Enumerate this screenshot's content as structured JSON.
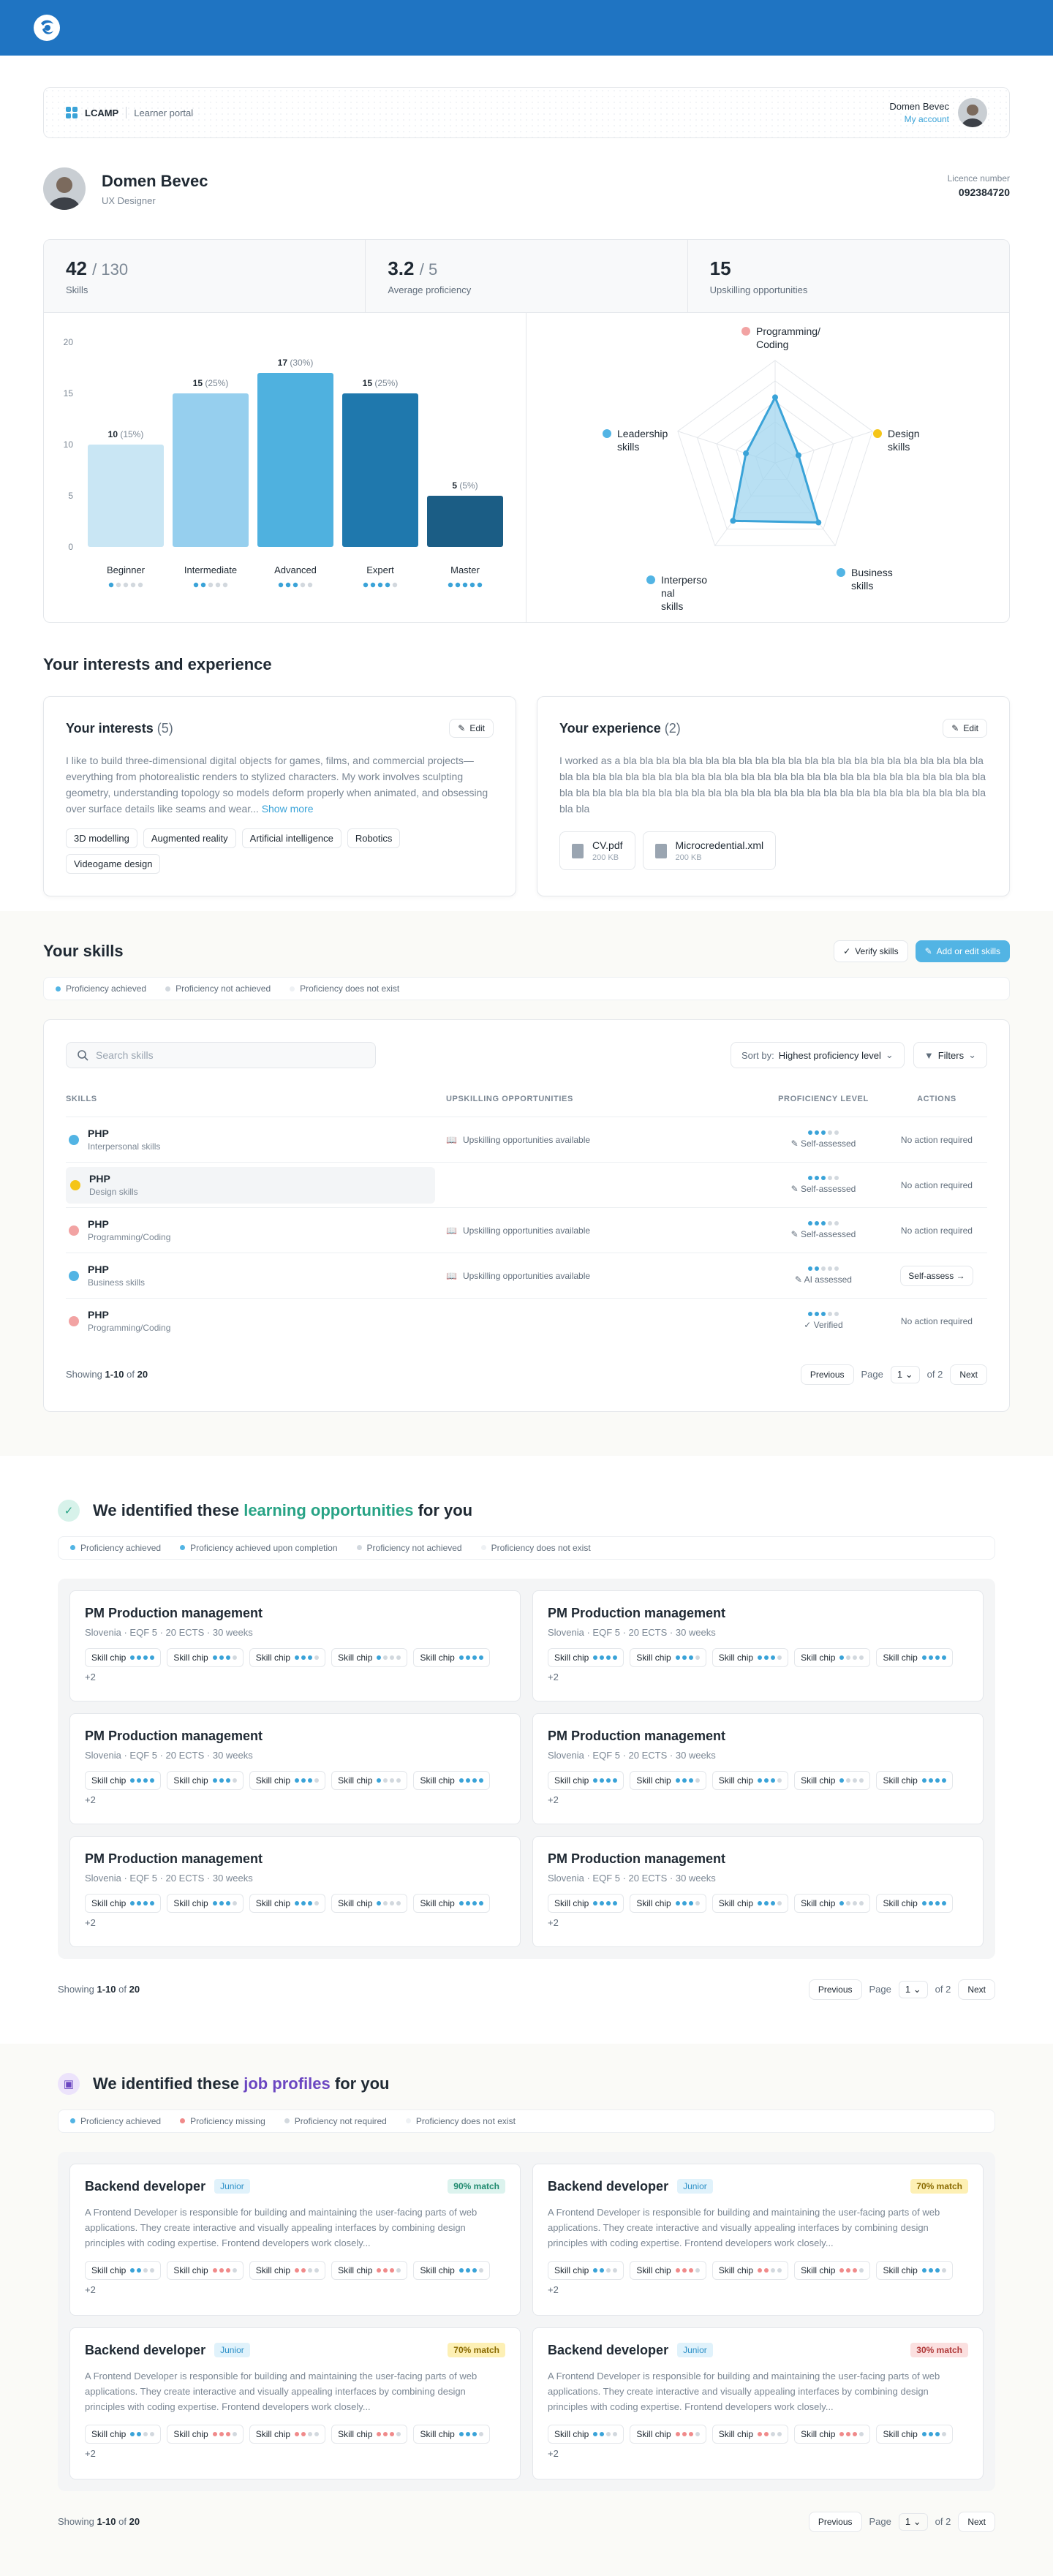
{
  "portal": {
    "brand": "LCAMP",
    "subtitle": "Learner portal",
    "user_name": "Domen Bevec",
    "account_link": "My account"
  },
  "profile": {
    "name": "Domen Bevec",
    "role": "UX Designer",
    "licence_label": "Licence number",
    "licence_value": "092384720"
  },
  "stats": [
    {
      "value": "42",
      "of": "/ 130",
      "label": "Skills"
    },
    {
      "value": "3.2",
      "of": "/ 5",
      "label": "Average proficiency"
    },
    {
      "value": "15",
      "of": "",
      "label": "Upskilling opportunities"
    }
  ],
  "chart_data": [
    {
      "type": "bar",
      "categories": [
        "Beginner",
        "Intermediate",
        "Advanced",
        "Expert",
        "Master"
      ],
      "values": [
        10,
        15,
        17,
        15,
        5
      ],
      "labels": [
        "10 (15%)",
        "15 (25%)",
        "17 (30%)",
        "15 (25%)",
        "5 (5%)"
      ],
      "level_dots": [
        1,
        2,
        3,
        4,
        5
      ],
      "ylim": [
        0,
        20
      ],
      "yticks": [
        0,
        5,
        10,
        15,
        20
      ],
      "colors": [
        "#c9e6f4",
        "#96cfee",
        "#4fb1df",
        "#1f78ad",
        "#1b5d85"
      ]
    },
    {
      "type": "radar",
      "axes": [
        "Programming/ Coding",
        "Design skills",
        "Business skills",
        "Interperso nal skills",
        "Leadership skills"
      ],
      "axis_colors": [
        "#f2a3a3",
        "#f5c518",
        "#52b4e4",
        "#52b4e4",
        "#52b4e4"
      ],
      "values": [
        3.2,
        1.2,
        3.6,
        3.5,
        1.5
      ],
      "max": 5,
      "rings": 5,
      "fill": "#9bd3ee",
      "stroke": "#3aa3d8"
    }
  ],
  "interests": {
    "section_title": "Your interests and experience",
    "title": "Your interests",
    "count": "(5)",
    "edit": "Edit",
    "text": "I like to build three-dimensional digital objects for games, films, and commercial projects—everything from photorealistic renders to stylized characters. My work involves sculpting geometry, understanding topology so models deform properly when animated, and obsessing over surface details like seams and wear...",
    "more": "Show more",
    "chips": [
      "3D modelling",
      "Augmented reality",
      "Artificial intelligence",
      "Robotics",
      "Videogame design"
    ]
  },
  "experience": {
    "title": "Your experience",
    "count": "(2)",
    "edit": "Edit",
    "text": "I worked as a bla bla bla bla bla bla bla bla bla bla bla bla bla bla bla bla bla bla bla bla bla bla bla bla bla bla bla bla bla bla bla bla bla bla bla bla bla bla bla bla bla bla bla bla bla bla bla bla bla bla bla bla bla bla bla bla bla bla bla bla bla bla bla bla bla bla bla bla bla bla bla bla bla bla bla bla",
    "files": [
      {
        "name": "CV.pdf",
        "size": "200 KB"
      },
      {
        "name": "Microcredential.xml",
        "size": "200 KB"
      }
    ]
  },
  "skills": {
    "title": "Your skills",
    "verify": "Verify skills",
    "add": "Add or edit skills",
    "legend": [
      {
        "label": "Proficiency achieved",
        "color": "#52b4e4"
      },
      {
        "label": "Proficiency not achieved",
        "color": "#d2d8de"
      },
      {
        "label": "Proficiency does not exist",
        "color": "#eef1f4"
      }
    ],
    "search_placeholder": "Search skills",
    "sort_label": "Sort by:",
    "sort_value": "Highest proficiency level",
    "filters": "Filters",
    "columns": [
      "SKILLS",
      "UPSKILLING OPPORTUNITIES",
      "PROFICIENCY LEVEL",
      "ACTIONS"
    ],
    "rows": [
      {
        "name": "PHP",
        "category": "Interpersonal skills",
        "color": "#52b4e4",
        "upskilling": "Upskilling opportunities available",
        "level": 3,
        "assessment": "Self-assessed",
        "action": "No action required",
        "is_button": false
      },
      {
        "name": "PHP",
        "category": "Design skills",
        "color": "#f5c518",
        "upskilling": "",
        "level": 3,
        "assessment": "Self-assessed",
        "action": "No action required",
        "is_button": false
      },
      {
        "name": "PHP",
        "category": "Programming/Coding",
        "color": "#f2a3a3",
        "upskilling": "Upskilling opportunities available",
        "level": 3,
        "assessment": "Self-assessed",
        "action": "No action required",
        "is_button": false
      },
      {
        "name": "PHP",
        "category": "Business skills",
        "color": "#52b4e4",
        "upskilling": "Upskilling opportunities available",
        "level": 2,
        "assessment": "AI assessed",
        "action": "Self-assess",
        "is_button": true
      },
      {
        "name": "PHP",
        "category": "Programming/Coding",
        "color": "#f2a3a3",
        "upskilling": "",
        "level": 3,
        "assessment": "Verified",
        "action": "No action required",
        "is_button": false
      }
    ],
    "showing_pre": "Showing",
    "showing_range": "1-10",
    "showing_of": "of",
    "showing_total": "20"
  },
  "pager": {
    "previous": "Previous",
    "page": "Page",
    "current": "1",
    "of": "of 2",
    "next": "Next"
  },
  "learning": {
    "title_pre": "We identified these",
    "title_hl": "learning opportunities",
    "title_post": "for you",
    "legend": [
      {
        "label": "Proficiency achieved",
        "color": "#52b4e4"
      },
      {
        "label": "Proficiency achieved upon completion",
        "color": "#52b4e4"
      },
      {
        "label": "Proficiency not achieved",
        "color": "#d2d8de"
      },
      {
        "label": "Proficiency does not exist",
        "color": "#eef1f4"
      }
    ],
    "cards": [
      {
        "title": "PM Production management",
        "meta": "Slovenia · EQF 5 · 20 ECTS · 30 weeks"
      },
      {
        "title": "PM Production management",
        "meta": "Slovenia · EQF 5 · 20 ECTS · 30 weeks"
      },
      {
        "title": "PM Production management",
        "meta": "Slovenia · EQF 5 · 20 ECTS · 30 weeks"
      },
      {
        "title": "PM Production management",
        "meta": "Slovenia · EQF 5 · 20 ECTS · 30 weeks"
      },
      {
        "title": "PM Production management",
        "meta": "Slovenia · EQF 5 · 20 ECTS · 30 weeks"
      },
      {
        "title": "PM Production management",
        "meta": "Slovenia · EQF 5 · 20 ECTS · 30 weeks"
      }
    ],
    "chip_label": "Skill chip",
    "more": "+2",
    "showing_pre": "Showing",
    "showing_range": "1-10",
    "showing_of": "of",
    "showing_total": "20"
  },
  "jobs": {
    "title_pre": "We identified these",
    "title_hl": "job profiles",
    "title_post": "for you",
    "legend": [
      {
        "label": "Proficiency achieved",
        "color": "#52b4e4"
      },
      {
        "label": "Proficiency missing",
        "color": "#f08a8a"
      },
      {
        "label": "Proficiency not required",
        "color": "#d2d8de"
      },
      {
        "label": "Proficiency does not exist",
        "color": "#eef1f4"
      }
    ],
    "cards": [
      {
        "title": "Backend developer",
        "level": "Junior",
        "match": "90% match",
        "match_bg": "#dcf3ee",
        "match_fg": "#1f8a6f"
      },
      {
        "title": "Backend developer",
        "level": "Junior",
        "match": "70% match",
        "match_bg": "#fdf0b5",
        "match_fg": "#8a6a00"
      },
      {
        "title": "Backend developer",
        "level": "Junior",
        "match": "70% match",
        "match_bg": "#fdf0b5",
        "match_fg": "#8a6a00"
      },
      {
        "title": "Backend developer",
        "level": "Junior",
        "match": "30% match",
        "match_bg": "#fbe0e0",
        "match_fg": "#b03a3a"
      }
    ],
    "description": "A Frontend Developer is responsible for building and maintaining the user-facing parts of web applications. They create interactive and visually appealing interfaces by combining design principles with coding expertise. Frontend developers work closely...",
    "chip_label": "Skill chip",
    "more": "+2",
    "showing_pre": "Showing",
    "showing_range": "1-10",
    "showing_of": "of",
    "showing_total": "20"
  }
}
